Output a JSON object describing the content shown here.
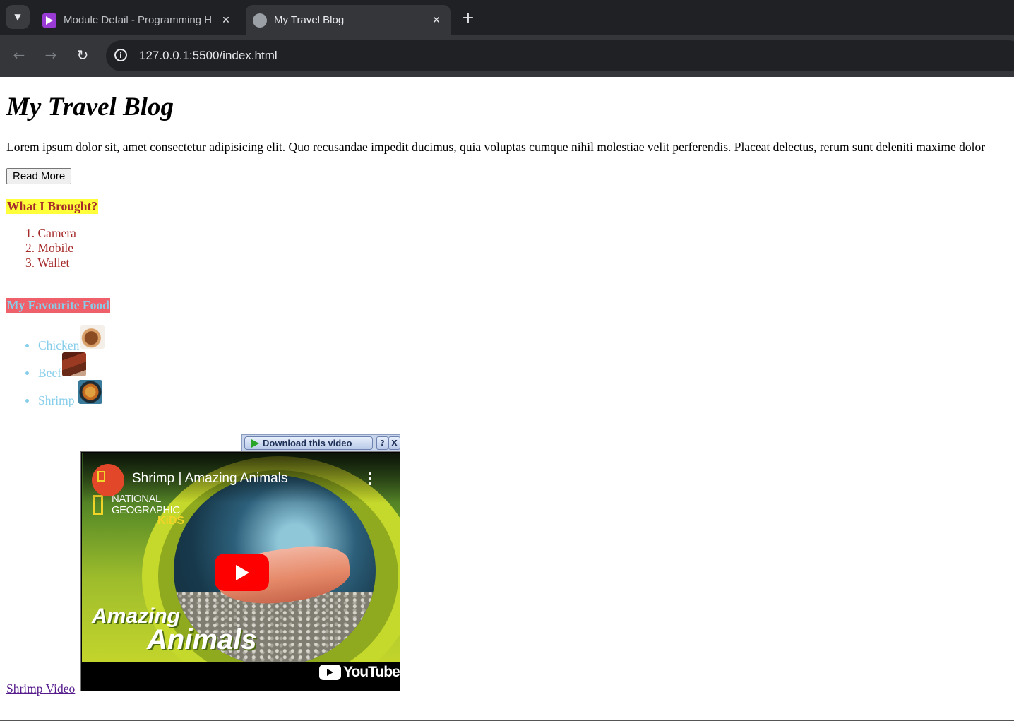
{
  "browser": {
    "tabs": [
      {
        "title": "Module Detail - Programming H",
        "icon": "programming-hero-icon",
        "active": false
      },
      {
        "title": "My Travel Blog",
        "icon": "globe-icon",
        "active": true
      }
    ],
    "new_tab": "+",
    "url": "127.0.0.1:5500/index.html"
  },
  "page": {
    "heading": "My Travel Blog",
    "intro": "Lorem ipsum dolor sit, amet consectetur adipisicing elit. Quo recusandae impedit ducimus, quia voluptas cumque nihil molestiae velit perferendis. Placeat delectus, rerum sunt deleniti maxime dolor",
    "read_more": "Read More",
    "brought": {
      "heading": "What I Brought?",
      "items": [
        "Camera",
        "Mobile",
        "Wallet"
      ],
      "numbers": [
        "1.",
        "2.",
        "3."
      ]
    },
    "food": {
      "heading": "My Favourite Food",
      "items": [
        "Chicken",
        "Beef",
        "Shrimp"
      ]
    },
    "video_link": "Shrimp Video",
    "download_bar": {
      "label": "Download this video",
      "help": "?",
      "close": "X"
    },
    "video": {
      "title": "Shrimp | Amazing Animals",
      "brand_line1": "NATIONAL",
      "brand_line2": "GEOGRAPHIC",
      "brand_line3": "KiDS",
      "overlay_line1": "Amazing",
      "overlay_line2": "Animals",
      "platform": "YouTube"
    }
  },
  "colors": {
    "brought_heading_text": "#a52a2a",
    "brought_heading_bg": "#ffff3a",
    "food_heading_text": "#87ceeb",
    "food_heading_bg": "#f0606a",
    "link_visited": "#551a8b"
  }
}
